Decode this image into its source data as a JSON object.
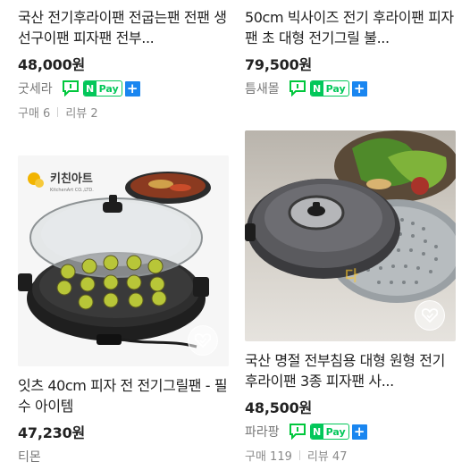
{
  "products": [
    {
      "title": "국산 전기후라이팬 전굽는팬 전팬 생선구이팬 피자팬 전부...",
      "price": "48,000원",
      "seller": "굿세라",
      "npay": "Pay",
      "purchase_count": "구매 6",
      "review_count": "리뷰 2"
    },
    {
      "title": "50cm 빅사이즈 전기 후라이팬 피자팬 초 대형 전기그릴 불...",
      "price": "79,500원",
      "seller": "틈새몰",
      "npay": "Pay"
    },
    {
      "title": "잇츠 40cm 피자 전 전기그릴팬 - 필수 아이템",
      "price": "47,230원",
      "seller": "티몬",
      "brand_logo_text": "키친아트",
      "brand_logo_sub": "KitchenArt CO.,LTD."
    },
    {
      "title": "국산 명절 전부침용 대형 원형 전기후라이팬 3종 피자팬 사...",
      "price": "48,500원",
      "seller": "파라팡",
      "npay": "Pay",
      "purchase_count": "구매 119",
      "review_count": "리뷰 47"
    }
  ],
  "colors": {
    "npay_green": "#03c75a",
    "plus_blue": "#1a86f0",
    "talk_green": "#00c73c"
  },
  "icons": [
    "talk-icon",
    "npay-badge",
    "plus-badge",
    "wishlist-heart-icon"
  ]
}
